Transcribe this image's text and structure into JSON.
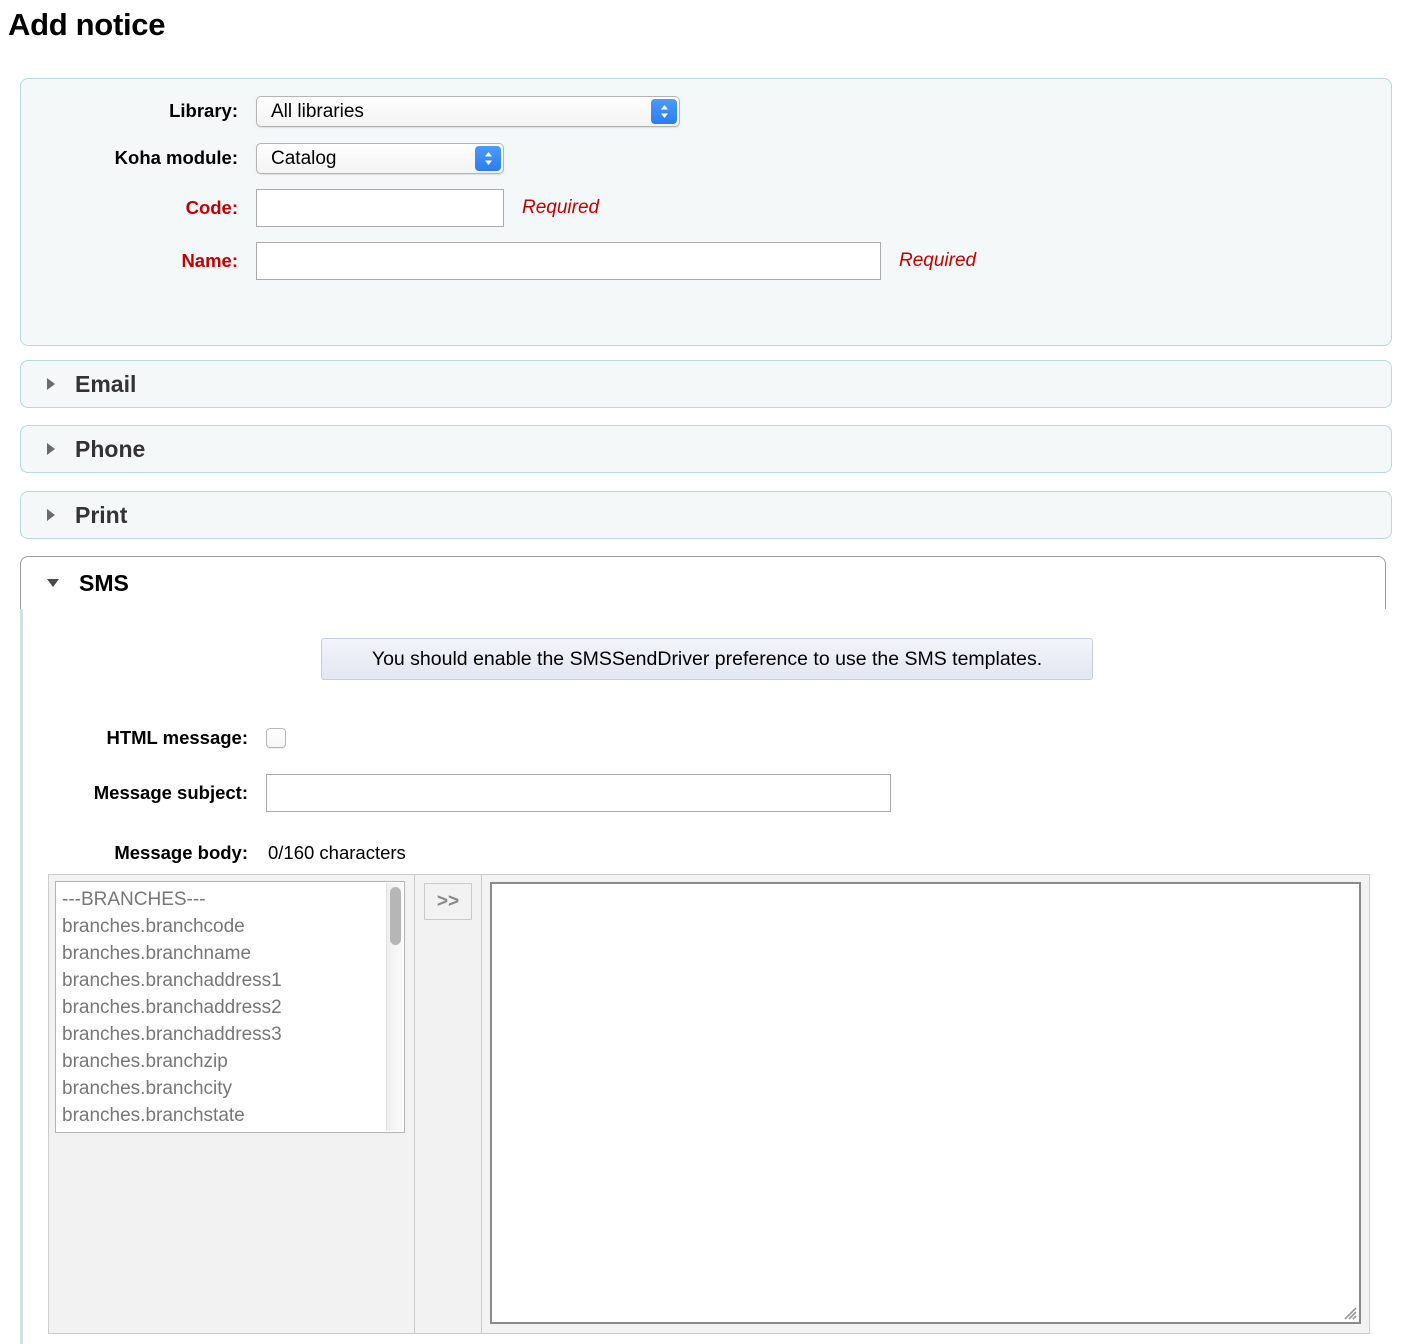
{
  "page": {
    "title": "Add notice"
  },
  "colors": {
    "panel_border": "#b9d8d9",
    "panel_bg": "#f4f8f9",
    "required_red": "#c60000",
    "select_accent_blue": "#3b8cf5"
  },
  "top_form": {
    "rows": [
      {
        "label": "Library:",
        "type": "select",
        "value": "All libraries"
      },
      {
        "label": "Koha module:",
        "type": "select",
        "value": "Catalog"
      },
      {
        "label": "Code:",
        "type": "text",
        "value": "",
        "note": "Required"
      },
      {
        "label": "Name:",
        "type": "text",
        "value": "",
        "note": "Required"
      }
    ]
  },
  "accordion": {
    "sections": [
      {
        "label": "Email",
        "expanded": false,
        "icon": "triangle-right-icon"
      },
      {
        "label": "Phone",
        "expanded": false,
        "icon": "triangle-right-icon"
      },
      {
        "label": "Print",
        "expanded": false,
        "icon": "triangle-right-icon"
      },
      {
        "label": "SMS",
        "expanded": true,
        "icon": "triangle-down-icon"
      }
    ]
  },
  "sms": {
    "alert": "You should enable the SMSSendDriver preference to use the SMS templates.",
    "html_message_label": "HTML message:",
    "html_message_checked": false,
    "message_subject_label": "Message subject:",
    "message_subject_value": "",
    "message_body_label": "Message body:",
    "character_count": "0/160 characters",
    "insert_button_label": ">>",
    "message_body_value": "",
    "field_list": [
      "---BRANCHES---",
      "branches.branchcode",
      "branches.branchname",
      "branches.branchaddress1",
      "branches.branchaddress2",
      "branches.branchaddress3",
      "branches.branchzip",
      "branches.branchcity",
      "branches.branchstate"
    ]
  }
}
